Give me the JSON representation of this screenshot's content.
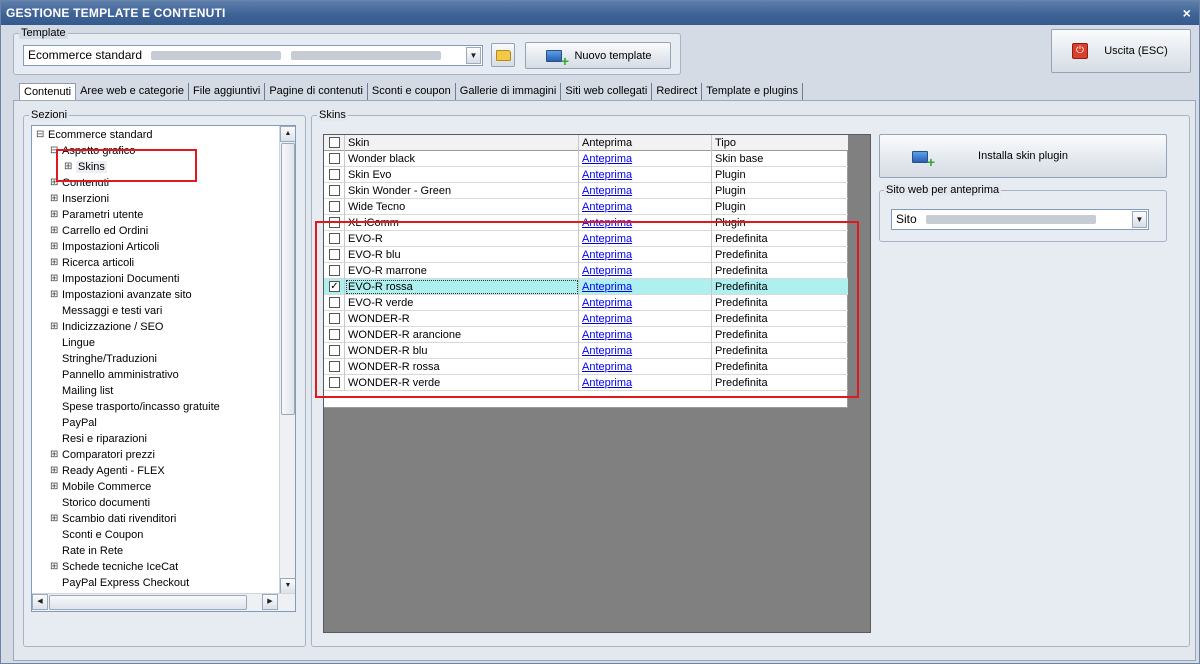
{
  "window": {
    "title": "GESTIONE TEMPLATE E CONTENUTI",
    "close_glyph": "×"
  },
  "template": {
    "label": "Template",
    "selected": "Ecommerce standard",
    "new_button": "Nuovo template"
  },
  "exit_button": "Uscita (ESC)",
  "tabs": [
    "Contenuti",
    "Aree web e categorie",
    "File aggiuntivi",
    "Pagine di contenuti",
    "Sconti e coupon",
    "Gallerie di immagini",
    "Siti web collegati",
    "Redirect",
    "Template e plugins"
  ],
  "sections": {
    "label": "Sezioni",
    "tree": [
      {
        "label": "Ecommerce standard",
        "expander": "⊟"
      },
      {
        "label": "Aspetto grafico",
        "expander": "⊟"
      },
      {
        "label": "Skins",
        "expander": "⊞"
      },
      {
        "label": "Contenuti",
        "expander": "⊞"
      },
      {
        "label": "Inserzioni",
        "expander": "⊞"
      },
      {
        "label": "Parametri utente",
        "expander": "⊞"
      },
      {
        "label": "Carrello ed Ordini",
        "expander": "⊞"
      },
      {
        "label": "Impostazioni Articoli",
        "expander": "⊞"
      },
      {
        "label": "Ricerca articoli",
        "expander": "⊞"
      },
      {
        "label": "Impostazioni Documenti",
        "expander": "⊞"
      },
      {
        "label": "Impostazioni avanzate sito",
        "expander": "⊞"
      },
      {
        "label": "Messaggi e testi vari",
        "expander": ""
      },
      {
        "label": "Indicizzazione / SEO",
        "expander": "⊞"
      },
      {
        "label": "Lingue",
        "expander": ""
      },
      {
        "label": "Stringhe/Traduzioni",
        "expander": ""
      },
      {
        "label": "Pannello amministrativo",
        "expander": ""
      },
      {
        "label": "Mailing list",
        "expander": ""
      },
      {
        "label": "Spese trasporto/incasso gratuite",
        "expander": ""
      },
      {
        "label": "PayPal",
        "expander": ""
      },
      {
        "label": "Resi e riparazioni",
        "expander": ""
      },
      {
        "label": "Comparatori prezzi",
        "expander": "⊞"
      },
      {
        "label": "Ready Agenti - FLEX",
        "expander": "⊞"
      },
      {
        "label": "Mobile Commerce",
        "expander": "⊞"
      },
      {
        "label": "Storico documenti",
        "expander": ""
      },
      {
        "label": "Scambio dati rivenditori",
        "expander": "⊞"
      },
      {
        "label": "Sconti e Coupon",
        "expander": ""
      },
      {
        "label": "Rate in Rete",
        "expander": ""
      },
      {
        "label": "Schede tecniche IceCat",
        "expander": "⊞"
      },
      {
        "label": "PayPal Express Checkout",
        "expander": ""
      }
    ]
  },
  "skins": {
    "label": "Skins",
    "columns": {
      "skin": "Skin",
      "preview": "Anteprima",
      "type": "Tipo"
    },
    "rows": [
      {
        "skin": "Wonder black",
        "preview": "Anteprima",
        "type": "Skin base",
        "checked": false
      },
      {
        "skin": "Skin Evo",
        "preview": "Anteprima",
        "type": "Plugin",
        "checked": false
      },
      {
        "skin": "Skin Wonder - Green",
        "preview": "Anteprima",
        "type": "Plugin",
        "checked": false
      },
      {
        "skin": "Wide Tecno",
        "preview": "Anteprima",
        "type": "Plugin",
        "checked": false
      },
      {
        "skin": "XL iComm",
        "preview": "Anteprima",
        "type": "Plugin",
        "checked": false
      },
      {
        "skin": "EVO-R",
        "preview": "Anteprima",
        "type": "Predefinita",
        "checked": false
      },
      {
        "skin": "EVO-R blu",
        "preview": "Anteprima",
        "type": "Predefinita",
        "checked": false
      },
      {
        "skin": "EVO-R marrone",
        "preview": "Anteprima",
        "type": "Predefinita",
        "checked": false
      },
      {
        "skin": "EVO-R rossa",
        "preview": "Anteprima",
        "type": "Predefinita",
        "checked": true
      },
      {
        "skin": "EVO-R verde",
        "preview": "Anteprima",
        "type": "Predefinita",
        "checked": false
      },
      {
        "skin": "WONDER-R",
        "preview": "Anteprima",
        "type": "Predefinita",
        "checked": false
      },
      {
        "skin": "WONDER-R arancione",
        "preview": "Anteprima",
        "type": "Predefinita",
        "checked": false
      },
      {
        "skin": "WONDER-R blu",
        "preview": "Anteprima",
        "type": "Predefinita",
        "checked": false
      },
      {
        "skin": "WONDER-R rossa",
        "preview": "Anteprima",
        "type": "Predefinita",
        "checked": false
      },
      {
        "skin": "WONDER-R verde",
        "preview": "Anteprima",
        "type": "Predefinita",
        "checked": false
      }
    ]
  },
  "install_button": "Installa skin plugin",
  "preview_site": {
    "label": "Sito web per anteprima",
    "selected": "Sito"
  },
  "colors": {
    "selected_row": "#aef0ef",
    "highlight": "#e0191d",
    "titlebar": "#3f6395"
  }
}
